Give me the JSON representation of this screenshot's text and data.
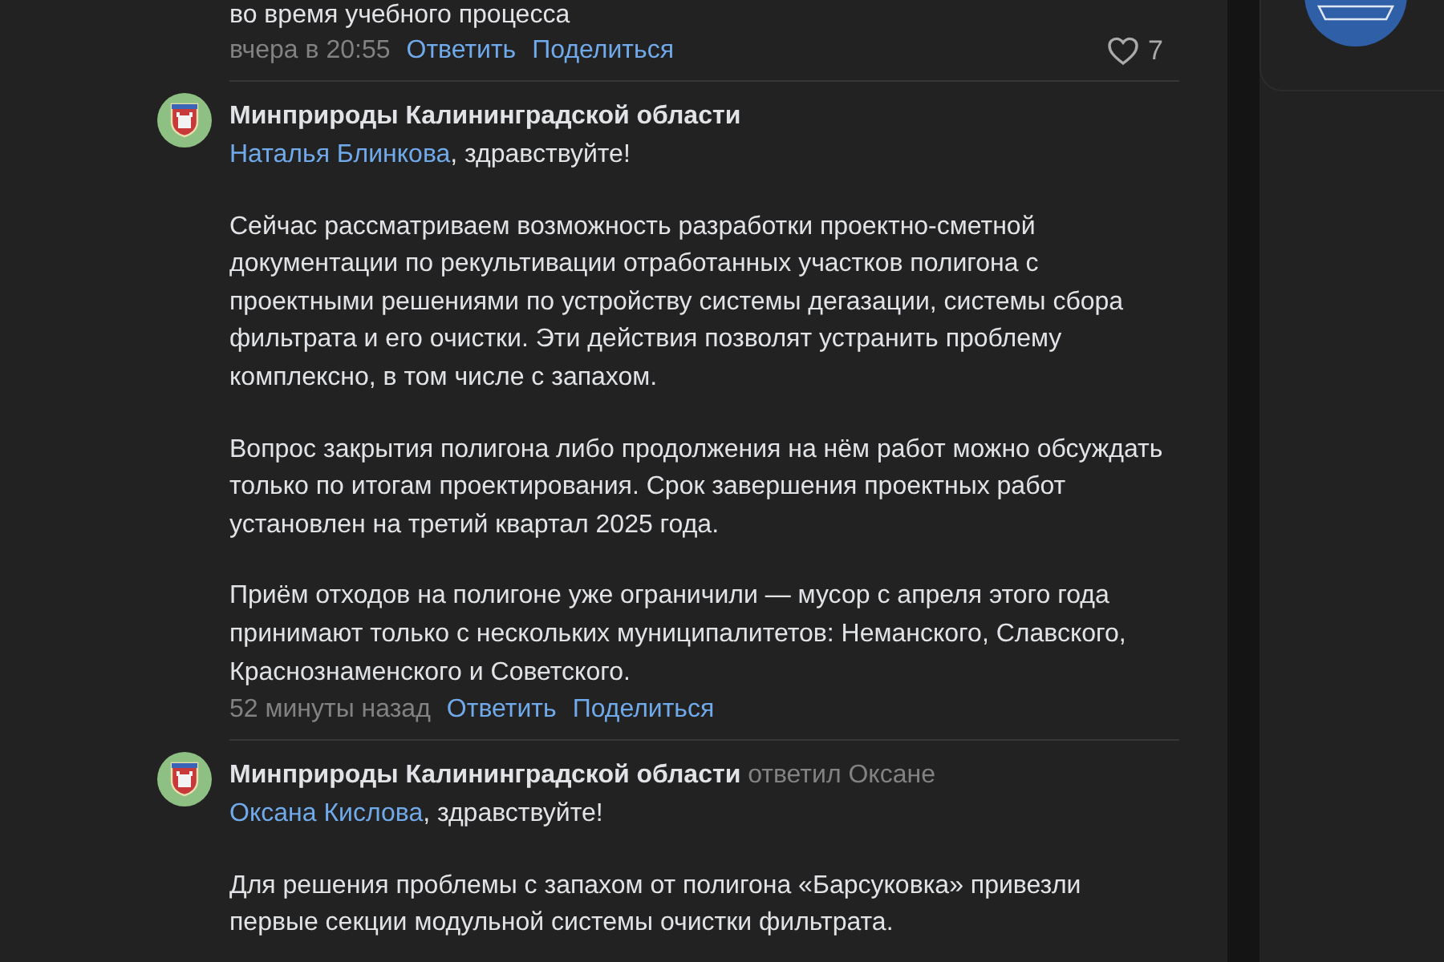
{
  "comments": [
    {
      "text": "во время учебного процесса",
      "time": "вчера в 20:55",
      "actions": [
        "Ответить",
        "Поделиться"
      ],
      "likes": "7",
      "liked": false
    },
    {
      "author": "Минприроды Калининградской области",
      "greeting_name": "Наталья Блинкова",
      "greeting": ", здравствуйте!",
      "paragraphs": [
        "Сейчас рассматриваем возможность разработки проектно-сметной документации по рекультивации отработанных участков полигона с проектными решениями по устройству системы дегазации, системы сбора фильтрата и его очистки. Эти действия позволят устранить проблему комплексно, в том числе с запахом.",
        "Вопрос закрытия полигона либо продолжения на нём работ можно обсуждать только по итогам проектирования. Срок завершения проектных работ установлен на третий квартал 2025 года.",
        "Приём отходов на полигоне уже ограничили — мусор с апреля этого года принимают только с нескольких муниципалитетов: Неманского, Славского, Краснознаменского и Советского."
      ],
      "time": "52 минуты назад",
      "actions": [
        "Ответить",
        "Поделиться"
      ]
    },
    {
      "author": "Минприроды Калининградской области",
      "reply_note": "ответил Оксане",
      "greeting_name": "Оксана Кислова",
      "greeting": ", здравствуйте!",
      "paragraphs": [
        "Для решения проблемы с запахом от полигона «Барсуковка» привезли первые секции модульной системы очистки фильтрата."
      ]
    }
  ]
}
